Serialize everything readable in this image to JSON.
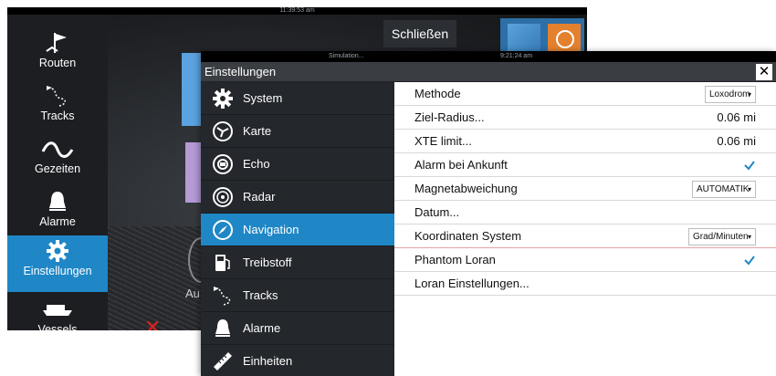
{
  "background": {
    "status_time": "11:39:53 am",
    "close_button": "Schließen",
    "partial_label": "Au",
    "sidebar": [
      {
        "label": "Routen",
        "icon": "route-flag-icon"
      },
      {
        "label": "Tracks",
        "icon": "track-trail-icon"
      },
      {
        "label": "Gezeiten",
        "icon": "tide-wave-icon"
      },
      {
        "label": "Alarme",
        "icon": "bell-icon"
      },
      {
        "label": "Einstellungen",
        "icon": "gear-icon",
        "active": true
      },
      {
        "label": "Vessels",
        "icon": "vessel-icon"
      }
    ]
  },
  "dialog": {
    "status_left": "Simulation...",
    "status_right": "9:21:24 am",
    "title": "Einstellungen",
    "nav": [
      {
        "label": "System",
        "icon": "gear-icon"
      },
      {
        "label": "Karte",
        "icon": "chart-icon"
      },
      {
        "label": "Echo",
        "icon": "echo-icon"
      },
      {
        "label": "Radar",
        "icon": "radar-icon"
      },
      {
        "label": "Navigation",
        "icon": "compass-icon",
        "active": true
      },
      {
        "label": "Treibstoff",
        "icon": "fuel-pump-icon"
      },
      {
        "label": "Tracks",
        "icon": "track-trail-icon"
      },
      {
        "label": "Alarme",
        "icon": "bell-icon"
      },
      {
        "label": "Einheiten",
        "icon": "ruler-icon"
      }
    ],
    "rows": {
      "methode": {
        "label": "Methode",
        "value": "Loxodrom"
      },
      "ziel_radius": {
        "label": "Ziel-Radius...",
        "value": "0.06 mi"
      },
      "xte_limit": {
        "label": "XTE limit...",
        "value": "0.06 mi"
      },
      "alarm_ankunft": {
        "label": "Alarm bei Ankunft",
        "checked": true
      },
      "magnetabweichung": {
        "label": "Magnetabweichung",
        "value": "AUTOMATIK"
      },
      "datum": {
        "label": "Datum..."
      },
      "koordinaten": {
        "label": "Koordinaten System",
        "value": "Grad/Minuten"
      },
      "phantom_loran": {
        "label": "Phantom Loran",
        "checked": true
      },
      "loran_einstellungen": {
        "label": "Loran Einstellungen..."
      }
    },
    "colors": {
      "accent": "#1f87c6",
      "nav_bg": "#24272b",
      "title_bg": "#3a3d42"
    }
  }
}
